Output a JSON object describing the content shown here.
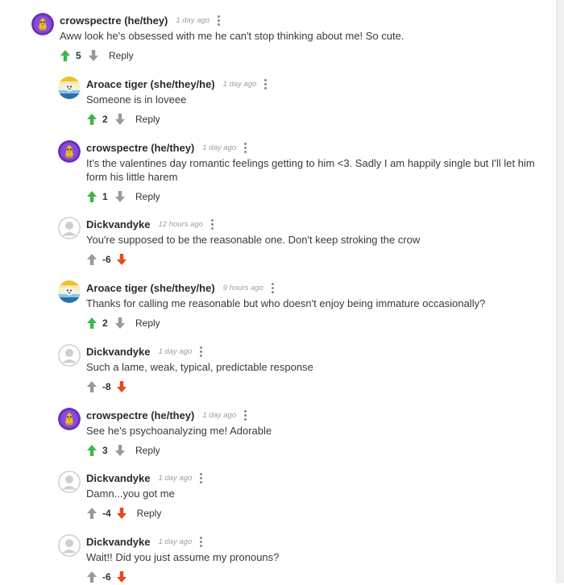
{
  "colors": {
    "upvote_active": "#3fb54a",
    "downvote_active": "#e8461d",
    "vote_inactive": "#9a9a9a",
    "author_text": "#2b2b2b",
    "timestamp_text": "#9e9e9e"
  },
  "comments": [
    {
      "author": "crowspectre (he/they)",
      "time": "1 day ago",
      "text": "Aww look he's obsessed with me he can't stop thinking about me! So cute.",
      "score": "5",
      "vote": "up",
      "reply_label": "Reply",
      "avatar_icon": "crow-avatar-icon"
    },
    {
      "author": "Aroace tiger (she/they/he)",
      "time": "1 day ago",
      "text": "Someone is in loveee",
      "score": "2",
      "vote": "up",
      "reply_label": "Reply",
      "avatar_icon": "tiger-avatar-icon"
    },
    {
      "author": "crowspectre (he/they)",
      "time": "1 day ago",
      "text": "It's the valentines day romantic feelings getting to him <3. Sadly I am happily single but I'll let him form his little harem",
      "score": "1",
      "vote": "up",
      "reply_label": "Reply",
      "avatar_icon": "crow-avatar-icon"
    },
    {
      "author": "Dickvandyke",
      "time": "12 hours ago",
      "text": "You're supposed to be the reasonable one. Don't keep stroking the crow",
      "score": "-6",
      "vote": "down",
      "reply_label": "",
      "avatar_icon": "default-user-avatar-icon"
    },
    {
      "author": "Aroace tiger (she/they/he)",
      "time": "9 hours ago",
      "text": "Thanks for calling me reasonable but who doesn't enjoy being immature occasionally?",
      "score": "2",
      "vote": "up",
      "reply_label": "Reply",
      "avatar_icon": "tiger-avatar-icon"
    },
    {
      "author": "Dickvandyke",
      "time": "1 day ago",
      "text": "Such a lame, weak, typical, predictable response",
      "score": "-8",
      "vote": "down",
      "reply_label": "",
      "avatar_icon": "default-user-avatar-icon"
    },
    {
      "author": "crowspectre (he/they)",
      "time": "1 day ago",
      "text": "See he's psychoanalyzing me! Adorable",
      "score": "3",
      "vote": "up",
      "reply_label": "Reply",
      "avatar_icon": "crow-avatar-icon"
    },
    {
      "author": "Dickvandyke",
      "time": "1 day ago",
      "text": "Damn...you got me",
      "score": "-4",
      "vote": "down",
      "reply_label": "Reply",
      "avatar_icon": "default-user-avatar-icon"
    },
    {
      "author": "Dickvandyke",
      "time": "1 day ago",
      "text": "Wait!! Did you just assume my pronouns?",
      "score": "-6",
      "vote": "down",
      "reply_label": "",
      "avatar_icon": "default-user-avatar-icon"
    }
  ]
}
